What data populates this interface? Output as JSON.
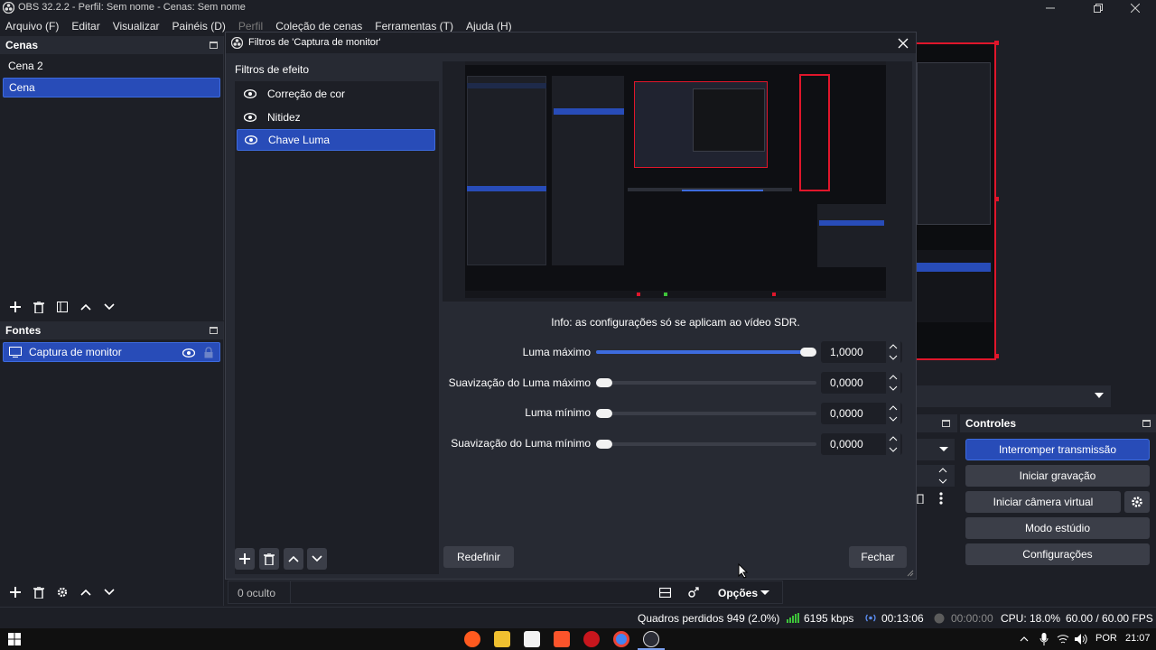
{
  "window": {
    "title": "OBS 32.2.2 - Perfil: Sem nome - Cenas: Sem nome"
  },
  "menu": {
    "items": [
      "Arquivo (F)",
      "Editar",
      "Visualizar",
      "Painéis (D)",
      "Perfil",
      "Coleção de cenas",
      "Ferramentas (T)",
      "Ajuda (H)"
    ]
  },
  "scenes": {
    "title": "Cenas",
    "items": [
      "Cena 2",
      "Cena"
    ],
    "selected": "Cena"
  },
  "sources": {
    "title": "Fontes",
    "items": [
      "Captura de monitor"
    ]
  },
  "dialog": {
    "title": "Filtros de 'Captura de monitor'",
    "effects_label": "Filtros de efeito",
    "filters": [
      "Correção de cor",
      "Nitidez",
      "Chave Luma"
    ],
    "selected_filter": "Chave Luma",
    "info": "Info: as configurações só se aplicam ao vídeo SDR.",
    "settings": [
      {
        "label": "Luma máximo",
        "value": "1,0000",
        "level": 1.0
      },
      {
        "label": "Suavização do Luma máximo",
        "value": "0,0000",
        "level": 0.0
      },
      {
        "label": "Luma mínimo",
        "value": "0,0000",
        "level": 0.0
      },
      {
        "label": "Suavização do Luma mínimo",
        "value": "0,0000",
        "level": 0.0
      }
    ],
    "reset_label": "Redefinir",
    "close_label": "Fechar"
  },
  "source_toolbar": {
    "hidden_count": "0 oculto",
    "options_label": "Opções"
  },
  "controls": {
    "title": "Controles",
    "stop_stream": "Interromper transmissão",
    "start_recording": "Iniciar gravação",
    "start_virtual_cam": "Iniciar câmera virtual",
    "studio_mode": "Modo estúdio",
    "settings": "Configurações"
  },
  "status": {
    "dropped_frames": "Quadros perdidos 949 (2.0%)",
    "bitrate": "6195 kbps",
    "stream_time": "00:13:06",
    "rec_time": "00:00:00",
    "cpu": "CPU: 18.0%",
    "fps": "60.00 / 60.00 FPS"
  },
  "taskbar": {
    "lang": "POR",
    "time": "21:07"
  },
  "colors": {
    "accent": "#284cb8",
    "bg": "#1d1f26",
    "panel": "#272a33",
    "red": "#e0162b",
    "green": "#3ec43a"
  }
}
